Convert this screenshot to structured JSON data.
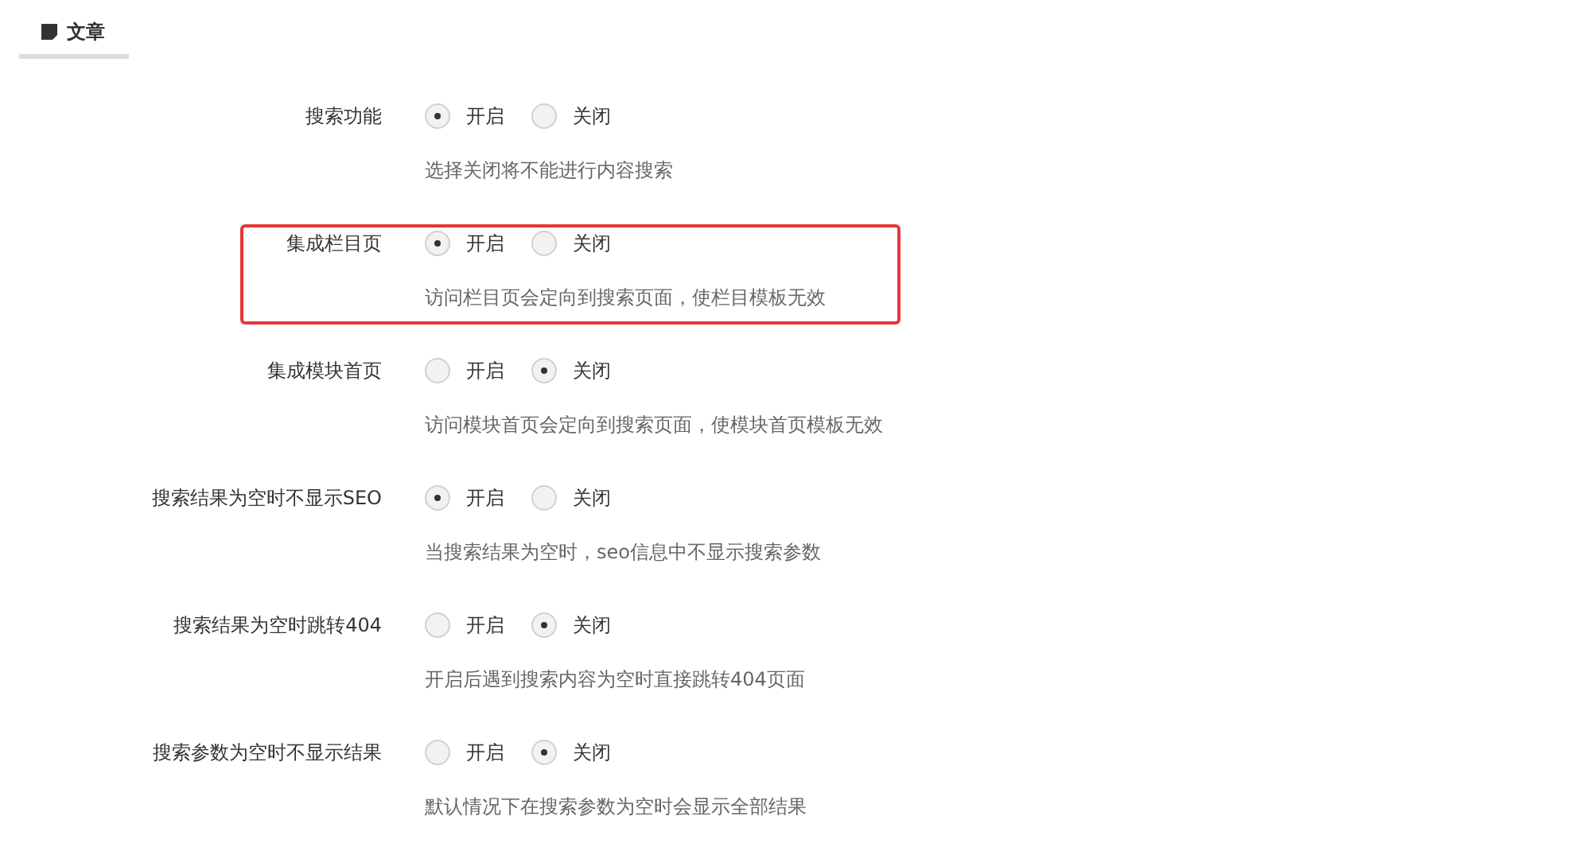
{
  "section_tab": {
    "label": "文章",
    "selected": true
  },
  "settings": [
    {
      "label": "搜索功能",
      "highlighted": false,
      "options": [
        {
          "label": "开启",
          "selected": true
        },
        {
          "label": "关闭",
          "selected": false
        }
      ],
      "hint": "选择关闭将不能进行内容搜索"
    },
    {
      "label": "集成栏目页",
      "highlighted": true,
      "options": [
        {
          "label": "开启",
          "selected": true
        },
        {
          "label": "关闭",
          "selected": false
        }
      ],
      "hint": "访问栏目页会定向到搜索页面，使栏目模板无效"
    },
    {
      "label": "集成模块首页",
      "highlighted": false,
      "options": [
        {
          "label": "开启",
          "selected": false
        },
        {
          "label": "关闭",
          "selected": true
        }
      ],
      "hint": "访问模块首页会定向到搜索页面，使模块首页模板无效"
    },
    {
      "label": "搜索结果为空时不显示SEO",
      "highlighted": false,
      "options": [
        {
          "label": "开启",
          "selected": true
        },
        {
          "label": "关闭",
          "selected": false
        }
      ],
      "hint": "当搜索结果为空时，seo信息中不显示搜索参数"
    },
    {
      "label": "搜索结果为空时跳转404",
      "highlighted": false,
      "options": [
        {
          "label": "开启",
          "selected": false
        },
        {
          "label": "关闭",
          "selected": true
        }
      ],
      "hint": "开启后遇到搜索内容为空时直接跳转404页面"
    },
    {
      "label": "搜索参数为空时不显示结果",
      "highlighted": false,
      "options": [
        {
          "label": "开启",
          "selected": false
        },
        {
          "label": "关闭",
          "selected": true
        }
      ],
      "hint": "默认情况下在搜索参数为空时会显示全部结果"
    }
  ]
}
